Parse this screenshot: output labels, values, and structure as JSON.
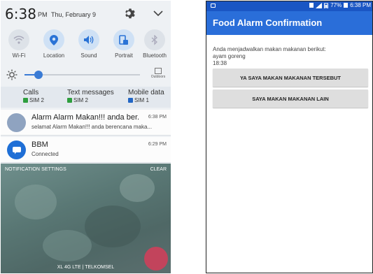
{
  "left_screen": {
    "header": {
      "time": "6:38",
      "ampm": "PM",
      "date": "Thu, February 9"
    },
    "quick_settings": [
      {
        "label": "Wi-Fi",
        "icon": "wifi-icon",
        "active": false
      },
      {
        "label": "Location",
        "icon": "location-pin-icon",
        "active": true
      },
      {
        "label": "Sound",
        "icon": "speaker-icon",
        "active": true
      },
      {
        "label": "Portrait",
        "icon": "portrait-rotation-icon",
        "active": true
      },
      {
        "label": "Bluetooth",
        "icon": "bluetooth-icon",
        "active": false
      }
    ],
    "brightness": {
      "level": 0.12,
      "outdoors_label": "Outdoors"
    },
    "sim_row": [
      {
        "label": "Calls",
        "sim": "SIM 2",
        "color": "#2e9e3e"
      },
      {
        "label": "Text messages",
        "sim": "SIM 2",
        "color": "#2e9e3e"
      },
      {
        "label": "Mobile data",
        "sim": "SIM 1",
        "color": "#2266c4"
      }
    ],
    "notifications": [
      {
        "title": "Alarm Alarm Makan!!! anda ber...",
        "body": "selamat Alarm Makan!!! anda berencana maka...",
        "time": "6:38 PM",
        "icon": "app-avatar-icon"
      },
      {
        "title": "BBM",
        "body": "Connected",
        "time": "6:29 PM",
        "icon": "bbm-icon"
      }
    ],
    "notification_settings_label": "NOTIFICATION SETTINGS",
    "clear_label": "CLEAR",
    "carrier": "XL 4G LTE | TELKOMSEL"
  },
  "right_screen": {
    "status_bar": {
      "battery": "77%",
      "time": "6:38 PM"
    },
    "app_title": "Food Alarm Confirmation",
    "message": "Anda menjadwalkan makan makanan berikut:",
    "food": "ayam goreng",
    "time": "18:38",
    "buttons": [
      {
        "label": "YA SAYA MAKAN MAKANAN TERSEBUT"
      },
      {
        "label": "SAYA MAKAN MAKANAN LAIN"
      }
    ]
  },
  "colors": {
    "app_bar": "#2a6ed9",
    "status_bar": "#1a56c4",
    "accent_blue": "#3a7bd5",
    "sim_green": "#2e9e3e",
    "sim_blue": "#2266c4",
    "fab": "#c2445c"
  }
}
